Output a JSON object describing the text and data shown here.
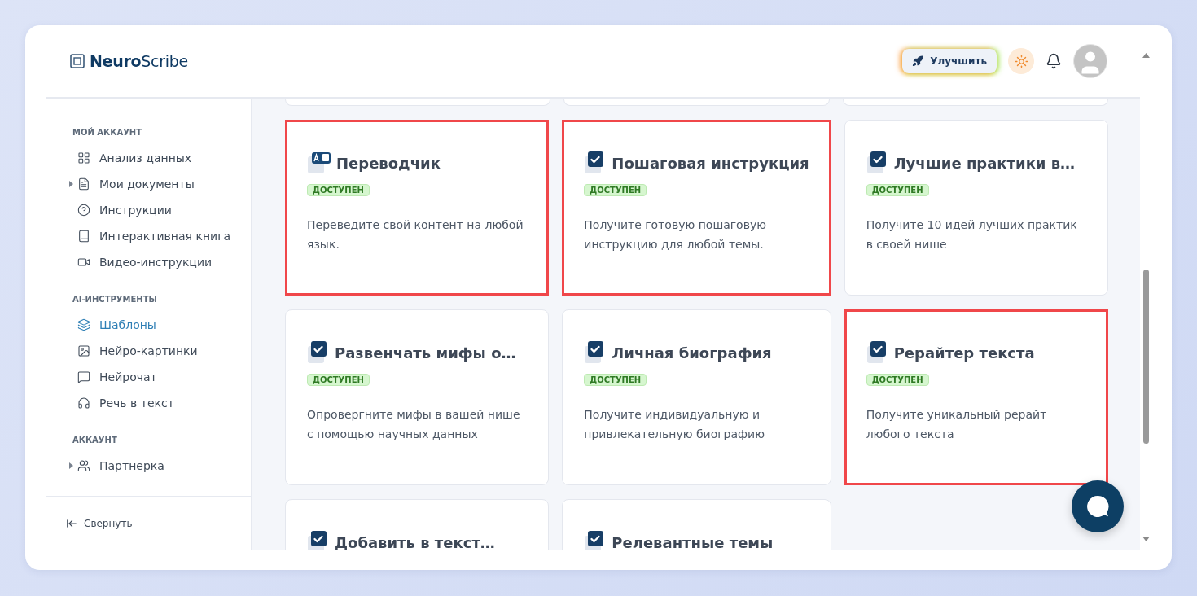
{
  "logo": {
    "text": "**Neuro**Scribe"
  },
  "header": {
    "upgrade_button": "Улучшить"
  },
  "sidebar": {
    "sections": [
      {
        "heading": "МОЙ АККАУНТ",
        "items": [
          {
            "label": "Анализ данных",
            "selected": false,
            "has_children": false
          },
          {
            "label": "Мои документы",
            "selected": false,
            "has_children": true
          },
          {
            "label": "Инструкции",
            "selected": false,
            "has_children": false
          },
          {
            "label": "Интерактивная книга",
            "selected": false,
            "has_children": false
          },
          {
            "label": "Видео-инструкции",
            "selected": false,
            "has_children": false
          }
        ]
      },
      {
        "heading": "AI-ИНСТРУМЕНТЫ",
        "items": [
          {
            "label": "Шаблоны",
            "selected": true,
            "has_children": false
          },
          {
            "label": "Нейро-картинки",
            "selected": false,
            "has_children": false
          },
          {
            "label": "Нейрочат",
            "selected": false,
            "has_children": false
          },
          {
            "label": "Речь в текст",
            "selected": false,
            "has_children": false
          }
        ]
      },
      {
        "heading": "АККАУНТ",
        "items": [
          {
            "label": "Партнерка",
            "selected": false,
            "has_children": true
          }
        ]
      }
    ],
    "collapse": "Свернуть"
  },
  "cards": [
    {
      "kind": "translate",
      "title": "Переводчик",
      "badge": "ДОСТУПЕН",
      "description": "Переведите свой контент на любой язык.",
      "highlighted": true
    },
    {
      "kind": "check",
      "title": "Пошаговая инструкция",
      "badge": "ДОСТУПЕН",
      "description": "Получите готовую пошаговую инструкцию для любой темы.",
      "highlighted": true
    },
    {
      "kind": "check",
      "title": "Лучшие практики в…",
      "badge": "ДОСТУПЕН",
      "description": "Получите 10 идей лучших практик в своей нише",
      "highlighted": false
    },
    {
      "kind": "check",
      "title": "Развенчать мифы о…",
      "badge": "ДОСТУПЕН",
      "description": "Опровергните мифы в вашей нише с помощью научных данных",
      "highlighted": false
    },
    {
      "kind": "check",
      "title": "Личная биография",
      "badge": "ДОСТУПЕН",
      "description": "Получите индивидуальную и привлекательную биографию",
      "highlighted": false
    },
    {
      "kind": "check",
      "title": "Рерайтер текста",
      "badge": "ДОСТУПЕН",
      "description": "Получите уникальный рерайт любого текста",
      "highlighted": true
    },
    {
      "kind": "check",
      "title": "Добавить в текст…",
      "highlighted": false
    },
    {
      "kind": "check",
      "title": "Релевантные темы",
      "highlighted": false
    }
  ]
}
